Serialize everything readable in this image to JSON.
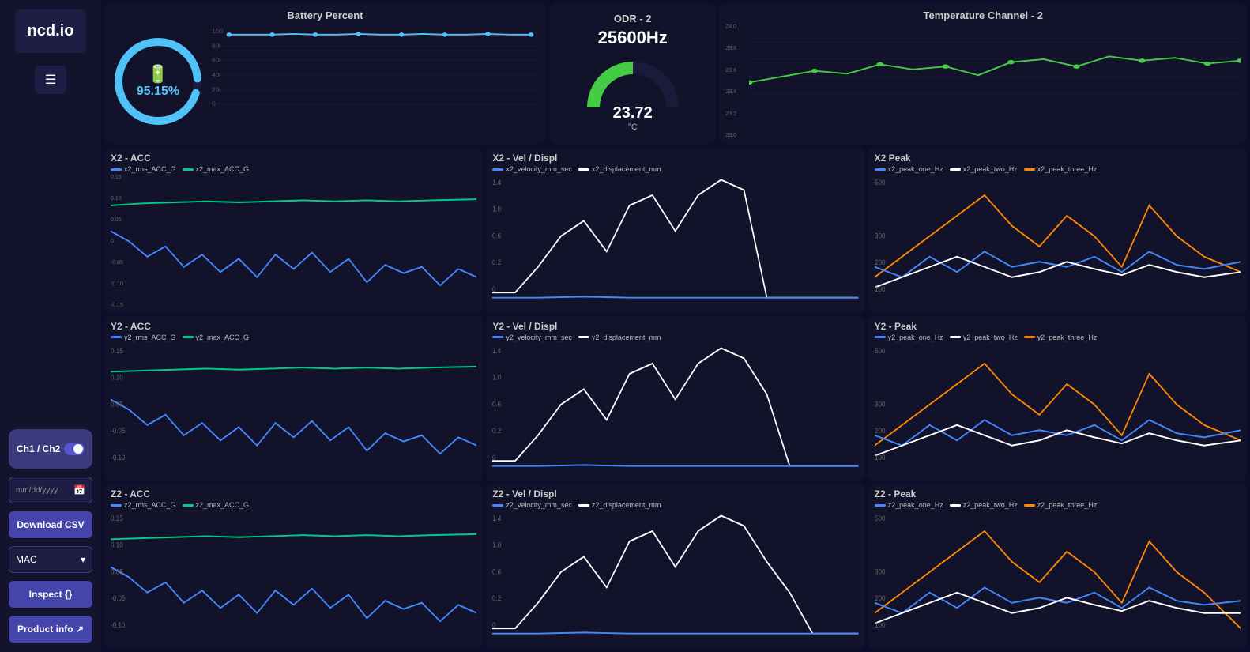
{
  "sidebar": {
    "logo": "ncd.io",
    "hamburger_label": "☰",
    "channel_toggle": {
      "label": "Ch1 / Ch2",
      "state": true
    },
    "date_input": {
      "placeholder": "mm/dd/yyyy",
      "icon": "📅"
    },
    "download_btn": "Download CSV",
    "mac_select": {
      "label": "MAC",
      "icon": "▾"
    },
    "inspect_btn": "Inspect  {}",
    "product_info_btn": "Product info  ↗"
  },
  "top": {
    "battery": {
      "title": "Battery Percent",
      "value": "95.15%",
      "icon": "🔋"
    },
    "odr": {
      "title": "ODR - 2",
      "freq": "25600Hz"
    },
    "temp": {
      "title": "Temperature Channel - 2",
      "value": "23.72",
      "unit": "°C"
    }
  },
  "charts": {
    "x2_acc": {
      "title": "X2 - ACC",
      "legend": [
        {
          "label": "x2_rms_ACC_G",
          "color": "#4488ff"
        },
        {
          "label": "x2_max_ACC_G",
          "color": "#00cc88"
        }
      ]
    },
    "x2_vel": {
      "title": "X2 - Vel / Displ",
      "legend": [
        {
          "label": "x2_velocity_mm_sec",
          "color": "#4488ff"
        },
        {
          "label": "x2_displacement_mm",
          "color": "#ffffff"
        }
      ]
    },
    "x2_peak": {
      "title": "X2 Peak",
      "legend": [
        {
          "label": "x2_peak_one_Hz",
          "color": "#4488ff"
        },
        {
          "label": "x2_peak_two_Hz",
          "color": "#ffffff"
        },
        {
          "label": "x2_peak_three_Hz",
          "color": "#ff8800"
        }
      ]
    },
    "y2_acc": {
      "title": "Y2 - ACC",
      "legend": [
        {
          "label": "y2_rms_ACC_G",
          "color": "#4488ff"
        },
        {
          "label": "y2_max_ACC_G",
          "color": "#00cc88"
        }
      ]
    },
    "y2_vel": {
      "title": "Y2 - Vel / Displ",
      "legend": [
        {
          "label": "y2_velocity_mm_sec",
          "color": "#4488ff"
        },
        {
          "label": "y2_displacement_mm",
          "color": "#ffffff"
        }
      ]
    },
    "y2_peak": {
      "title": "Y2 - Peak",
      "legend": [
        {
          "label": "y2_peak_one_Hz",
          "color": "#4488ff"
        },
        {
          "label": "y2_peak_two_Hz",
          "color": "#ffffff"
        },
        {
          "label": "y2_peak_three_Hz",
          "color": "#ff8800"
        }
      ]
    },
    "z2_acc": {
      "title": "Z2 - ACC",
      "legend": [
        {
          "label": "z2_rms_ACC_G",
          "color": "#4488ff"
        },
        {
          "label": "z2_max_ACC_G",
          "color": "#00cc88"
        }
      ]
    },
    "z2_vel": {
      "title": "Z2 - Vel / Displ",
      "legend": [
        {
          "label": "z2_velocity_mm_sec",
          "color": "#4488ff"
        },
        {
          "label": "z2_displacement_mm",
          "color": "#ffffff"
        }
      ]
    },
    "z2_peak": {
      "title": "Z2 - Peak",
      "legend": [
        {
          "label": "z2_peak_one_Hz",
          "color": "#4488ff"
        },
        {
          "label": "z2_peak_two_Hz",
          "color": "#ffffff"
        },
        {
          "label": "z2_peak_three_Hz",
          "color": "#ff8800"
        }
      ]
    }
  },
  "colors": {
    "bg": "#0d0d2b",
    "panel": "#12122b",
    "sidebar": "#13132e",
    "accent_blue": "#4444aa",
    "chart_blue": "#4488ff",
    "chart_green": "#00cc88",
    "chart_orange": "#ff8800",
    "chart_white": "#ffffff"
  }
}
